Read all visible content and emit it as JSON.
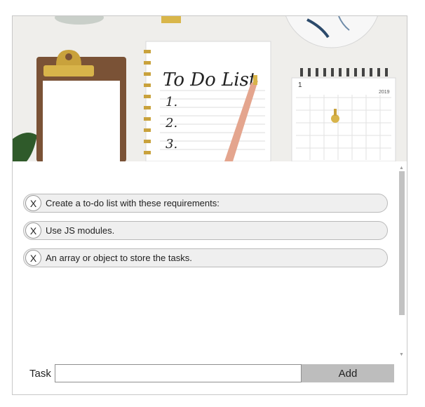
{
  "hero": {
    "alt": "To Do List",
    "heading": "To Do List",
    "numbers": [
      "1.",
      "2.",
      "3."
    ],
    "calendar_month": "1",
    "calendar_year": "2019"
  },
  "tasks": [
    {
      "remove_label": "X",
      "text": "Create a to-do list with these requirements:"
    },
    {
      "remove_label": "X",
      "text": "Use JS modules."
    },
    {
      "remove_label": "X",
      "text": "An array or object to store the tasks."
    }
  ],
  "form": {
    "label": "Task",
    "input_value": "",
    "add_label": "Add"
  },
  "icons": {
    "scroll_up": "scroll-up-arrow",
    "scroll_down": "scroll-down-arrow"
  },
  "colors": {
    "task_bg": "#efefef",
    "add_button_bg": "#bdbdbd",
    "scroll_thumb": "#c2c2c2"
  }
}
